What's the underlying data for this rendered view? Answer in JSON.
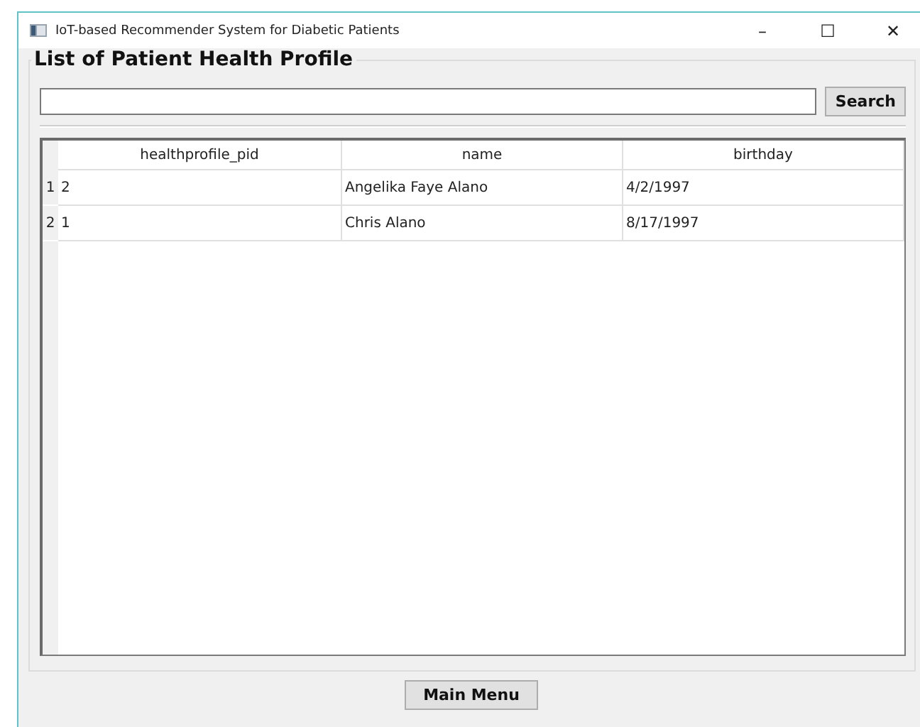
{
  "window": {
    "title": "IoT-based Recommender System for Diabetic Patients",
    "controls": [
      "–",
      "☐",
      "✕"
    ]
  },
  "group": {
    "title": "List of Patient Health Profile"
  },
  "search": {
    "button": "Search"
  },
  "table": {
    "columns": [
      "healthprofile_pid",
      "name",
      "birthday"
    ],
    "rows": [
      {
        "number": "1",
        "cells": [
          "2",
          "Angelika Faye Alano",
          "4/2/1997"
        ]
      },
      {
        "number": "2",
        "cells": [
          "1",
          "Chris Alano",
          "8/17/1997"
        ]
      }
    ]
  },
  "buttons": [
    "Main Menu"
  ]
}
